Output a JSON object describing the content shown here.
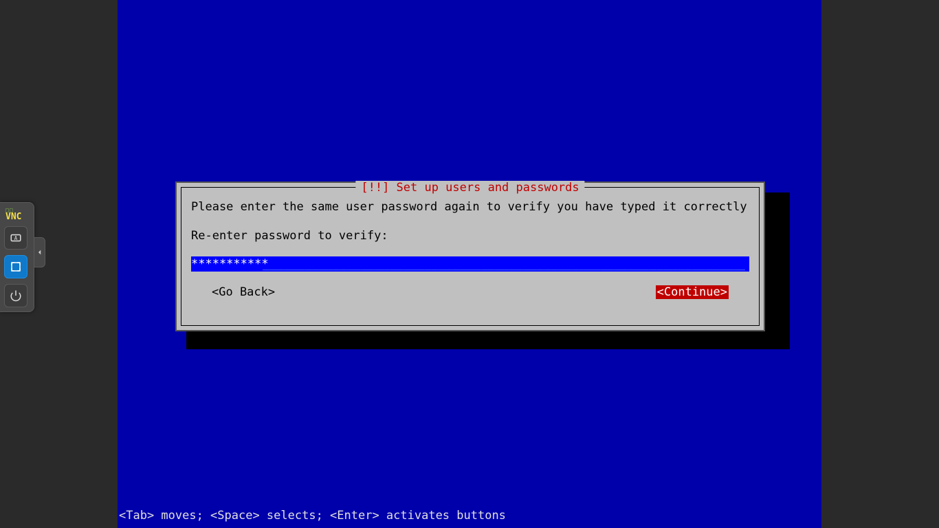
{
  "vnc_panel": {
    "logo_top": "□□",
    "logo_bot": "VNC",
    "keyboard_title": "Keyboard",
    "fullscreen_title": "Fullscreen",
    "power_title": "Power / Disconnect",
    "handle_title": "Collapse panel"
  },
  "dialog": {
    "title": "[!!] Set up users and passwords",
    "instruction": "Please enter the same user password again to verify you have typed it correctly.",
    "field_label": "Re-enter password to verify:",
    "password_mask": "***********",
    "underline_fill": "_______________________________________________________________________________________________________________",
    "go_back_label": "<Go Back>",
    "continue_label": "<Continue>"
  },
  "footer": {
    "help_text": "<Tab> moves; <Space> selects; <Enter> activates buttons"
  }
}
